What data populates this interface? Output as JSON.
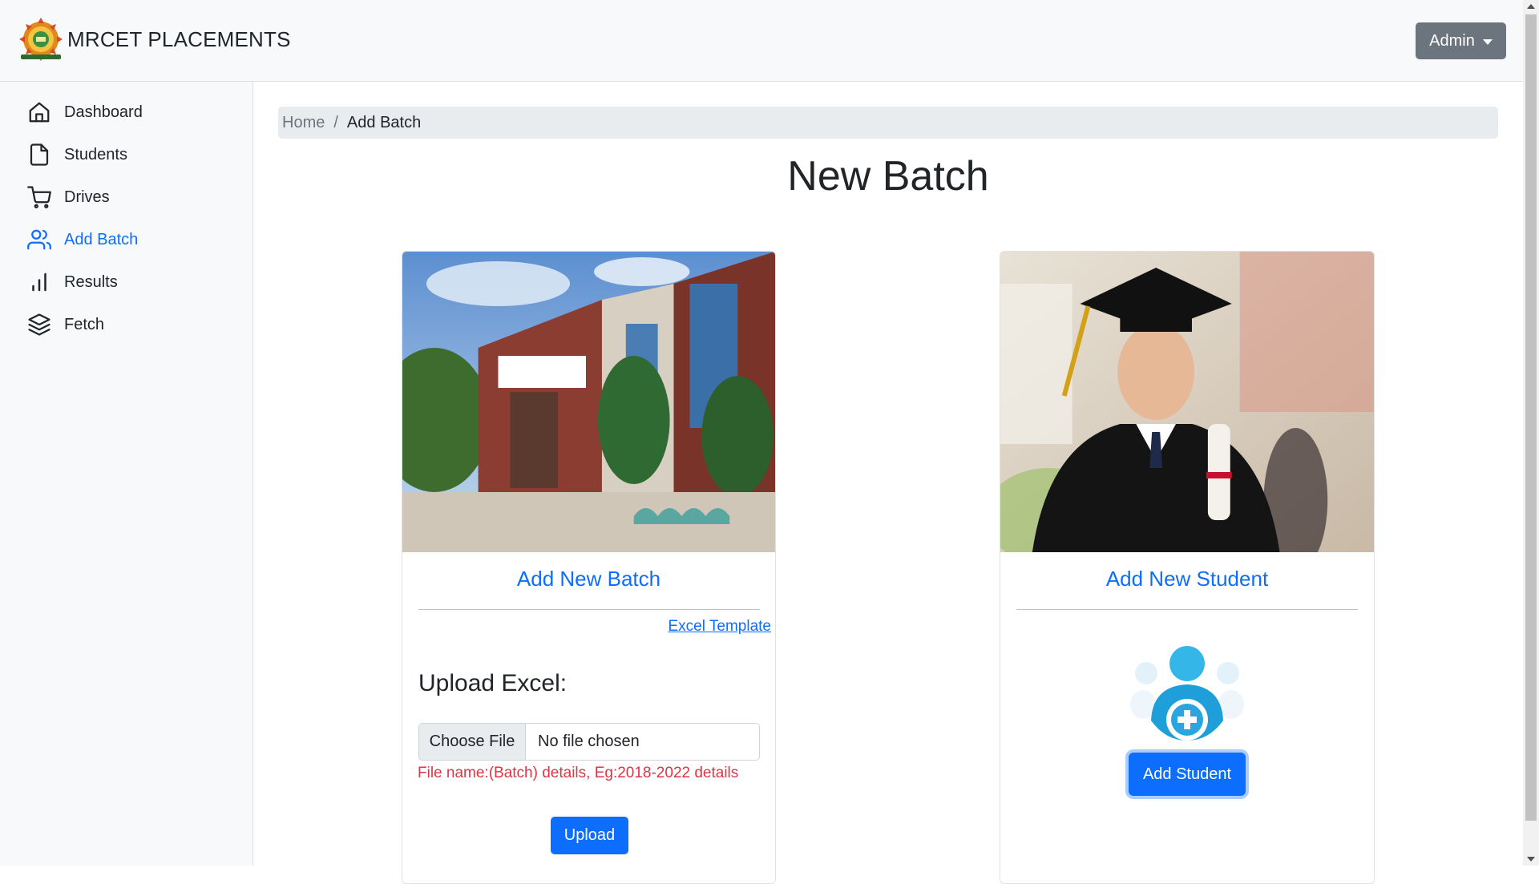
{
  "navbar": {
    "brand": "MRCET PLACEMENTS",
    "user_menu_label": "Admin"
  },
  "sidebar": {
    "items": [
      {
        "label": "Dashboard",
        "icon": "home-icon",
        "active": false
      },
      {
        "label": "Students",
        "icon": "file-icon",
        "active": false
      },
      {
        "label": "Drives",
        "icon": "cart-icon",
        "active": false
      },
      {
        "label": "Add Batch",
        "icon": "users-icon",
        "active": true
      },
      {
        "label": "Results",
        "icon": "bar-chart-icon",
        "active": false
      },
      {
        "label": "Fetch",
        "icon": "layers-icon",
        "active": false
      }
    ]
  },
  "breadcrumb": {
    "home": "Home",
    "separator": "/",
    "current": "Add Batch"
  },
  "page": {
    "title": "New Batch"
  },
  "batch_card": {
    "image": "college-building-photo",
    "title": "Add New Batch",
    "template_link": "Excel Template",
    "upload_label": "Upload Excel:",
    "file_button": "Choose File",
    "file_status": "No file chosen",
    "hint": "File name:(Batch) details, Eg:2018-2022 details",
    "upload_button": "Upload"
  },
  "student_card": {
    "image": "graduate-student-photo",
    "title": "Add New Student",
    "icon": "add-user-icon",
    "button": "Add Student"
  },
  "colors": {
    "primary": "#0d6efd",
    "secondary": "#6c757d",
    "danger": "#dc3545",
    "light": "#f8f9fa",
    "breadcrumb_bg": "#e9ecef"
  }
}
